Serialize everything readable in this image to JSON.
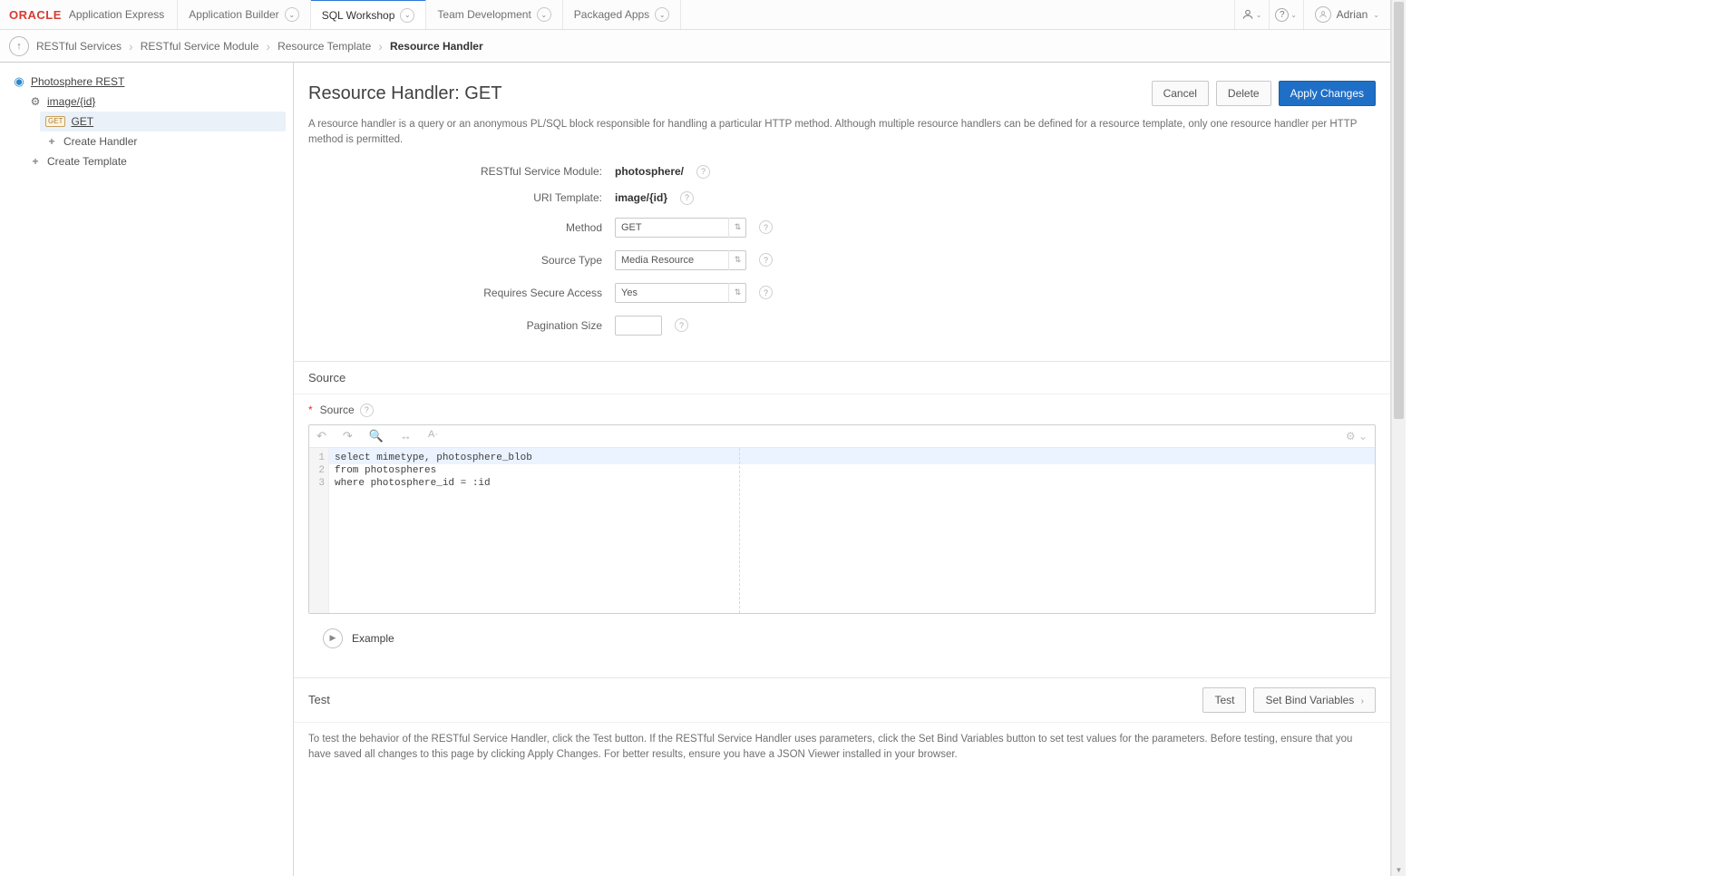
{
  "brand": {
    "logo": "ORACLE",
    "sub": "Application Express"
  },
  "topnav": {
    "app_builder": "Application Builder",
    "sql_workshop": "SQL Workshop",
    "team_dev": "Team Development",
    "packaged": "Packaged Apps"
  },
  "user": {
    "name": "Adrian"
  },
  "breadcrumb": {
    "items": [
      "RESTful Services",
      "RESTful Service Module",
      "Resource Template",
      "Resource Handler"
    ]
  },
  "sidebar": {
    "root": "Photosphere REST",
    "template": "image/{id}",
    "handler": "GET",
    "create_handler": "Create Handler",
    "create_template": "Create Template"
  },
  "page": {
    "title": "Resource Handler: GET",
    "buttons": {
      "cancel": "Cancel",
      "delete": "Delete",
      "apply": "Apply Changes"
    },
    "intro": "A resource handler is a query or an anonymous PL/SQL block responsible for handling a particular HTTP method. Although multiple resource handlers can be defined for a resource template, only one resource handler per HTTP method is permitted."
  },
  "form": {
    "labels": {
      "module": "RESTful Service Module:",
      "uri": "URI Template:",
      "method": "Method",
      "source_type": "Source Type",
      "secure": "Requires Secure Access",
      "pagination": "Pagination Size"
    },
    "values": {
      "module": "photosphere/",
      "uri": "image/{id}",
      "method": "GET",
      "source_type": "Media Resource",
      "secure": "Yes",
      "pagination": ""
    }
  },
  "source": {
    "section_title": "Source",
    "field_label": "Source",
    "code": {
      "line1": "select mimetype, photosphere_blob",
      "line2": "from photospheres",
      "line3": "where photosphere_id = :id"
    }
  },
  "example": {
    "label": "Example"
  },
  "test": {
    "title": "Test",
    "test_btn": "Test",
    "bind_btn": "Set Bind Variables",
    "desc": "To test the behavior of the RESTful Service Handler, click the Test button. If the RESTful Service Handler uses parameters, click the Set Bind Variables button to set test values for the parameters. Before testing, ensure that you have saved all changes to this page by clicking Apply Changes. For better results, ensure you have a JSON Viewer installed in your browser."
  }
}
